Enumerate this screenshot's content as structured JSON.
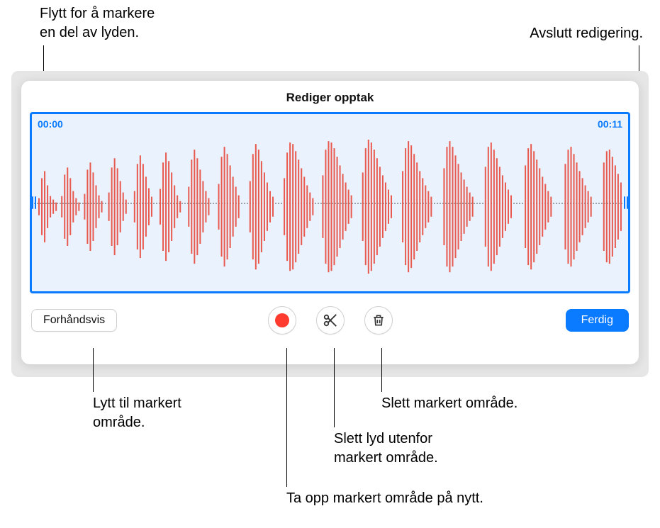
{
  "callouts": {
    "drag": "Flytt for å markere\nen del av lyden.",
    "finish": "Avslutt redigering.",
    "listen": "Lytt til markert\nområde.",
    "delete": "Slett markert område.",
    "trim": "Slett lyd utenfor\nmarkert område.",
    "rerecord": "Ta opp markert område på nytt."
  },
  "panel": {
    "title": "Rediger opptak",
    "time_start": "00:00",
    "time_end": "00:11"
  },
  "buttons": {
    "preview": "Forhåndsvis",
    "done": "Ferdig"
  },
  "colors": {
    "accent": "#0a7aff",
    "record": "#ff3b30",
    "waveform": "#e85a4f"
  }
}
